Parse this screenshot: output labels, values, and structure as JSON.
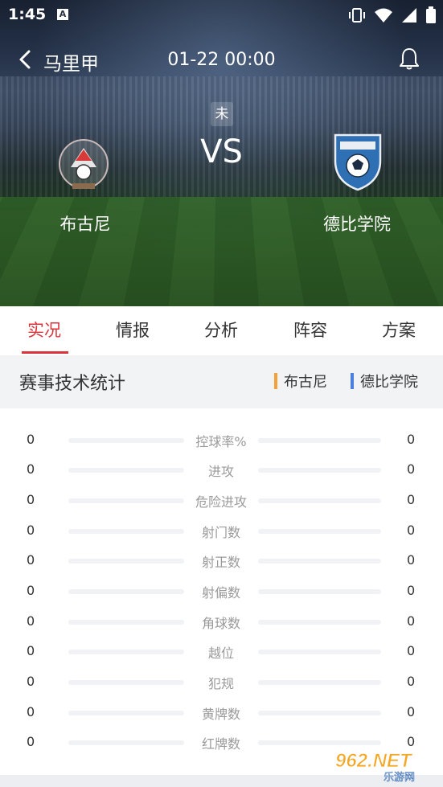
{
  "status_bar": {
    "time": "1:45",
    "notification_icon": "A"
  },
  "header": {
    "league": "马里甲",
    "datetime": "01-22 00:00"
  },
  "match": {
    "status": "未",
    "vs_text": "VS",
    "home_team": "布古尼",
    "away_team": "德比学院"
  },
  "tabs": [
    {
      "label": "实况",
      "active": true
    },
    {
      "label": "情报",
      "active": false
    },
    {
      "label": "分析",
      "active": false
    },
    {
      "label": "阵容",
      "active": false
    },
    {
      "label": "方案",
      "active": false
    }
  ],
  "stats": {
    "title": "赛事技术统计",
    "legend": [
      {
        "label": "布古尼",
        "color": "#f5a13a"
      },
      {
        "label": "德比学院",
        "color": "#4a7fe0"
      }
    ],
    "rows": [
      {
        "label": "控球率%",
        "home": "0",
        "away": "0"
      },
      {
        "label": "进攻",
        "home": "0",
        "away": "0"
      },
      {
        "label": "危险进攻",
        "home": "0",
        "away": "0"
      },
      {
        "label": "射门数",
        "home": "0",
        "away": "0"
      },
      {
        "label": "射正数",
        "home": "0",
        "away": "0"
      },
      {
        "label": "射偏数",
        "home": "0",
        "away": "0"
      },
      {
        "label": "角球数",
        "home": "0",
        "away": "0"
      },
      {
        "label": "越位",
        "home": "0",
        "away": "0"
      },
      {
        "label": "犯规",
        "home": "0",
        "away": "0"
      },
      {
        "label": "黄牌数",
        "home": "0",
        "away": "0"
      },
      {
        "label": "红牌数",
        "home": "0",
        "away": "0"
      }
    ]
  },
  "watermark": {
    "text": "962.NET",
    "subtext": "乐游网"
  },
  "colors": {
    "accent": "#d9333b",
    "home": "#f5a13a",
    "away": "#4a7fe0"
  }
}
